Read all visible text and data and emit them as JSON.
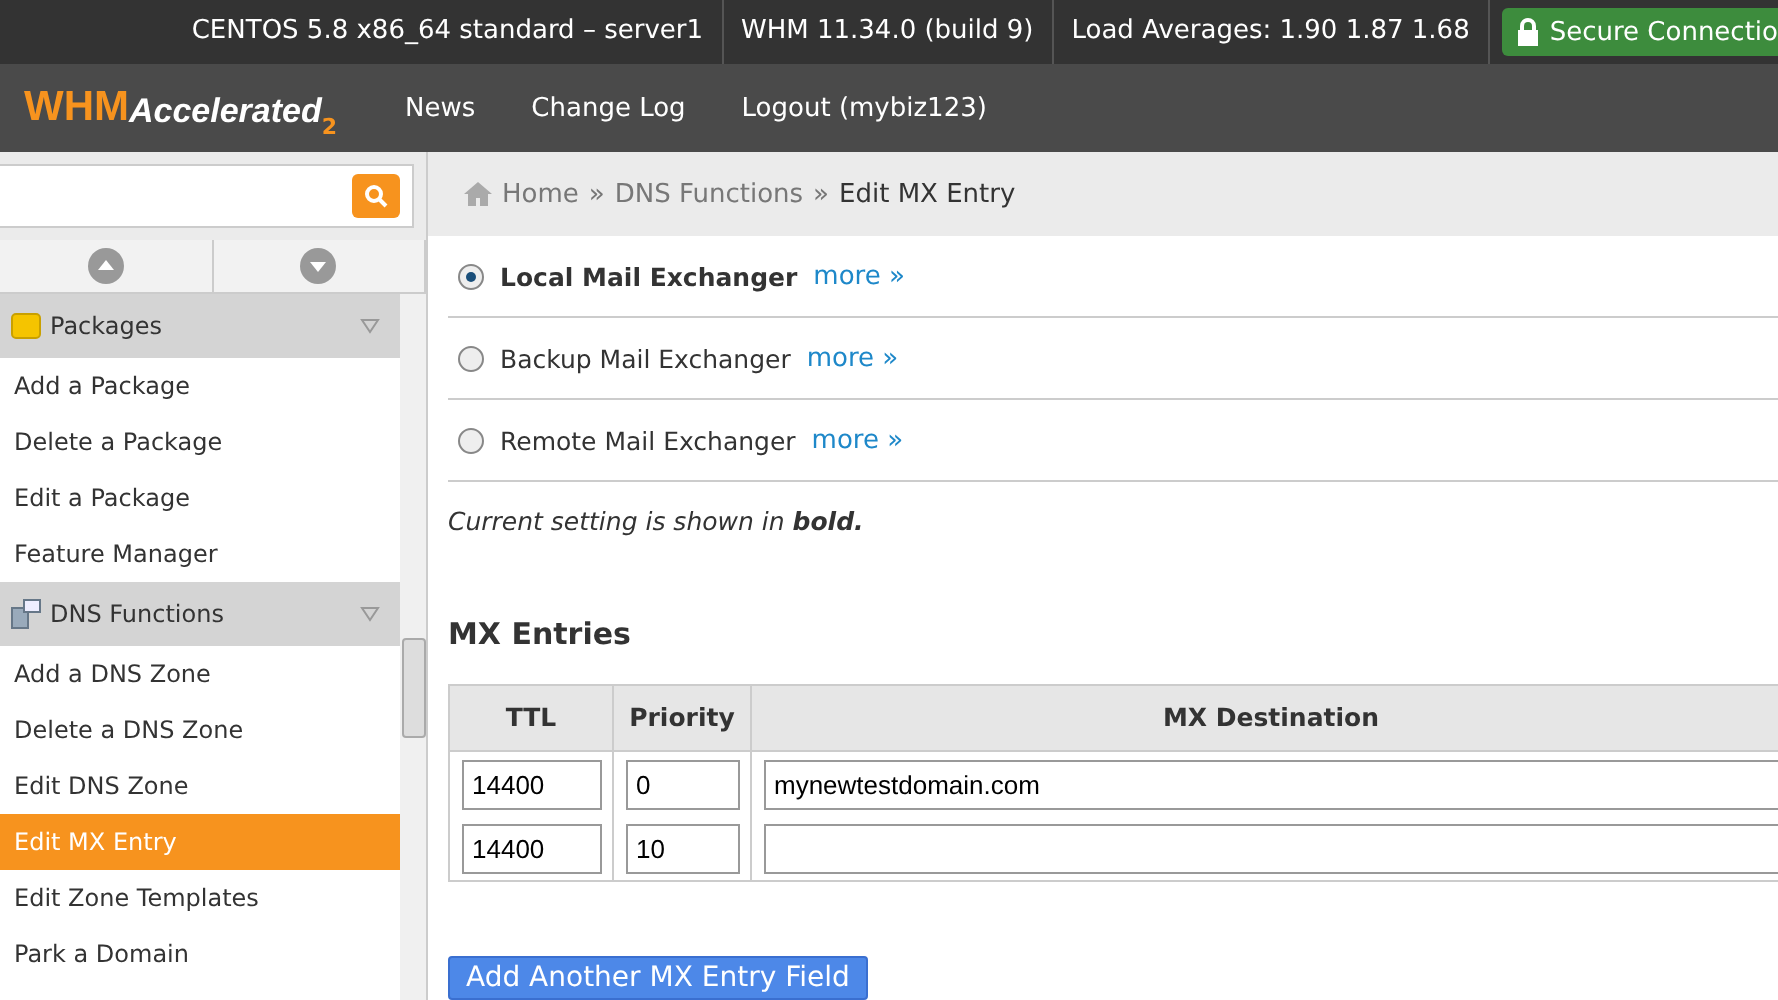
{
  "top_bar": {
    "items": [
      "CENTOS 5.8 x86_64 standard – server1",
      "WHM 11.34.0 (build 9)",
      "Load Averages: 1.90 1.87 1.68"
    ],
    "secure": "Secure Connectio"
  },
  "header": {
    "logo": {
      "main": "WHM",
      "sub": "Accelerated",
      "version": "2"
    },
    "nav": [
      "News",
      "Change Log",
      "Logout (mybiz123)"
    ]
  },
  "breadcrumb": {
    "separator": "»",
    "items": [
      "Home",
      "DNS Functions",
      "Edit MX Entry"
    ]
  },
  "sidebar": {
    "groups": [
      {
        "title": "Packages",
        "kind": "package",
        "items": [
          {
            "label": "Add a Package",
            "selected": false
          },
          {
            "label": "Delete a Package",
            "selected": false
          },
          {
            "label": "Edit a Package",
            "selected": false
          },
          {
            "label": "Feature Manager",
            "selected": false
          }
        ]
      },
      {
        "title": "DNS Functions",
        "kind": "dns",
        "items": [
          {
            "label": "Add a DNS Zone",
            "selected": false
          },
          {
            "label": "Delete a DNS Zone",
            "selected": false
          },
          {
            "label": "Edit DNS Zone",
            "selected": false
          },
          {
            "label": "Edit MX Entry",
            "selected": true
          },
          {
            "label": "Edit Zone Templates",
            "selected": false
          },
          {
            "label": "Park a Domain",
            "selected": false
          }
        ]
      }
    ]
  },
  "exchangers": [
    {
      "label": "Local Mail Exchanger",
      "link": "more »",
      "selected": true
    },
    {
      "label": "Backup Mail Exchanger",
      "link": "more »",
      "selected": false
    },
    {
      "label": "Remote Mail Exchanger",
      "link": "more »",
      "selected": false
    }
  ],
  "note": "Current setting is shown in **bold.**",
  "mx": {
    "heading": "MX Entries",
    "columns": [
      "TTL",
      "Priority",
      "MX Destination"
    ],
    "rows": [
      {
        "ttl": "14400",
        "priority": "0",
        "destination": "mynewtestdomain.com"
      },
      {
        "ttl": "14400",
        "priority": "10",
        "destination": ""
      }
    ],
    "button": "Add Another MX Entry Field"
  }
}
